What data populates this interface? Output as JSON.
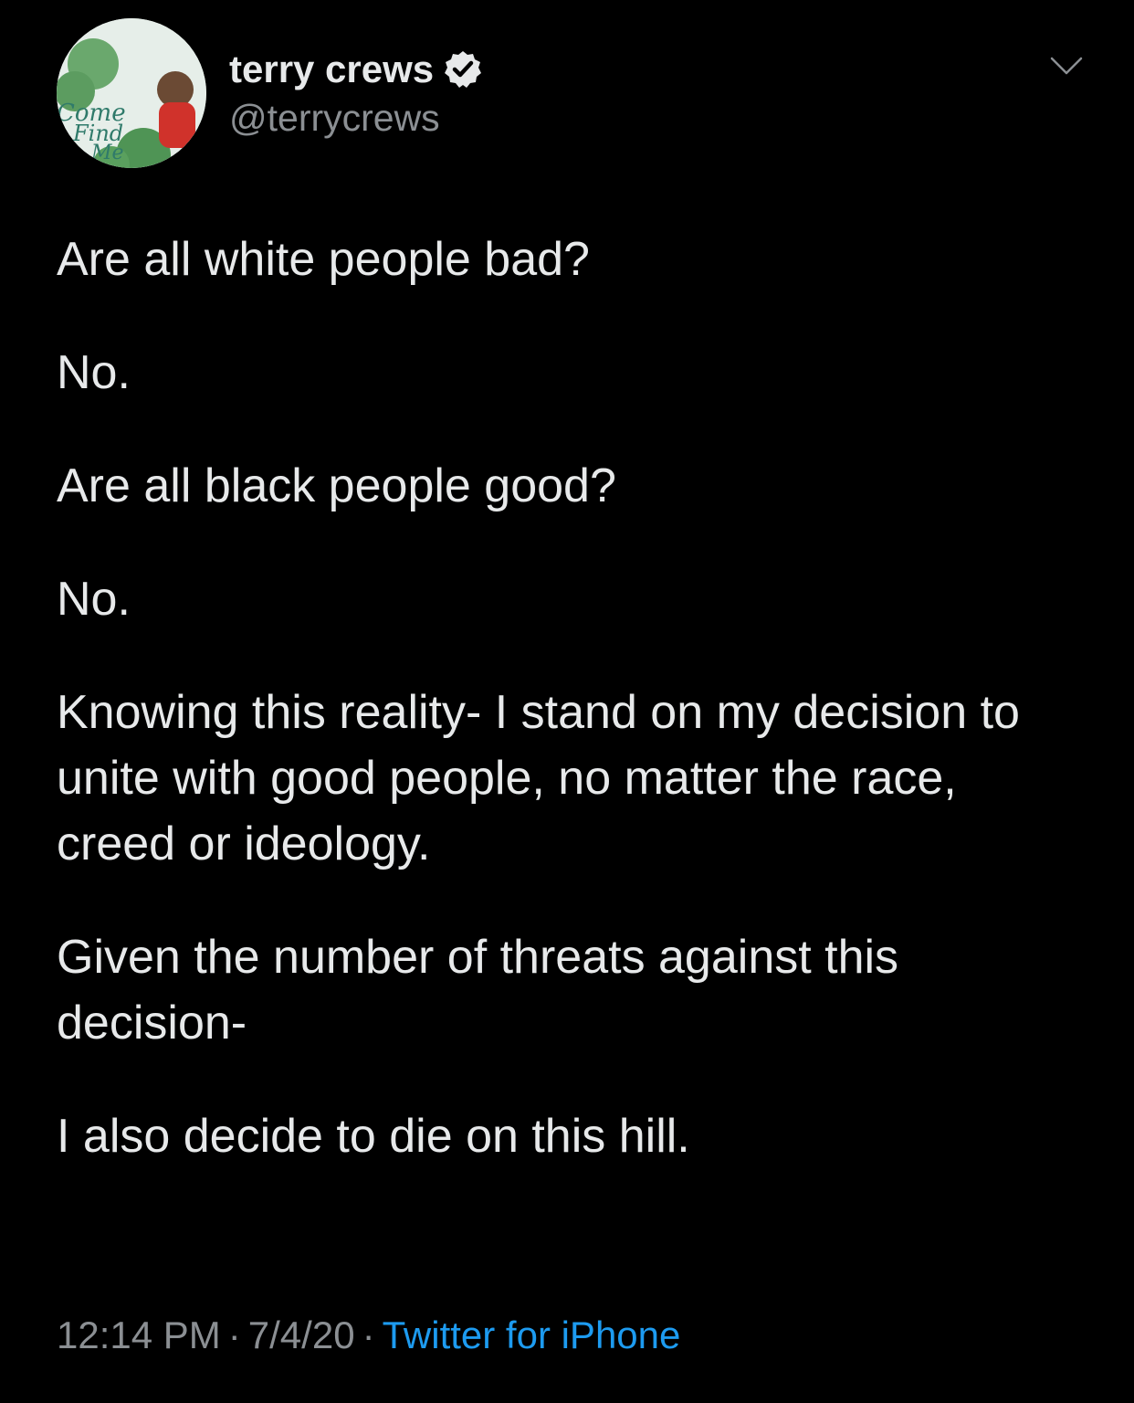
{
  "tweet": {
    "author": {
      "display_name": "terry crews",
      "handle": "@terrycrews",
      "verified": true,
      "avatar_text": [
        "Come",
        "Find",
        "Me"
      ],
      "verified_icon": "verified-badge-icon"
    },
    "menu_icon": "chevron-down-icon",
    "paragraphs": [
      "Are all white people bad?",
      "No.",
      "Are all black people good?",
      "No.",
      "Knowing this reality- I stand on my decision to unite with good people, no matter the race, creed or ideology.",
      "Given the number of threats against this decision-",
      "I also decide to die on this hill."
    ],
    "time": "12:14 PM",
    "date": "7/4/20",
    "separator": "·",
    "source": "Twitter for iPhone"
  },
  "colors": {
    "background": "#000000",
    "text": "#e7e9ea",
    "muted": "#8b8f93",
    "link": "#1d9bf0"
  }
}
